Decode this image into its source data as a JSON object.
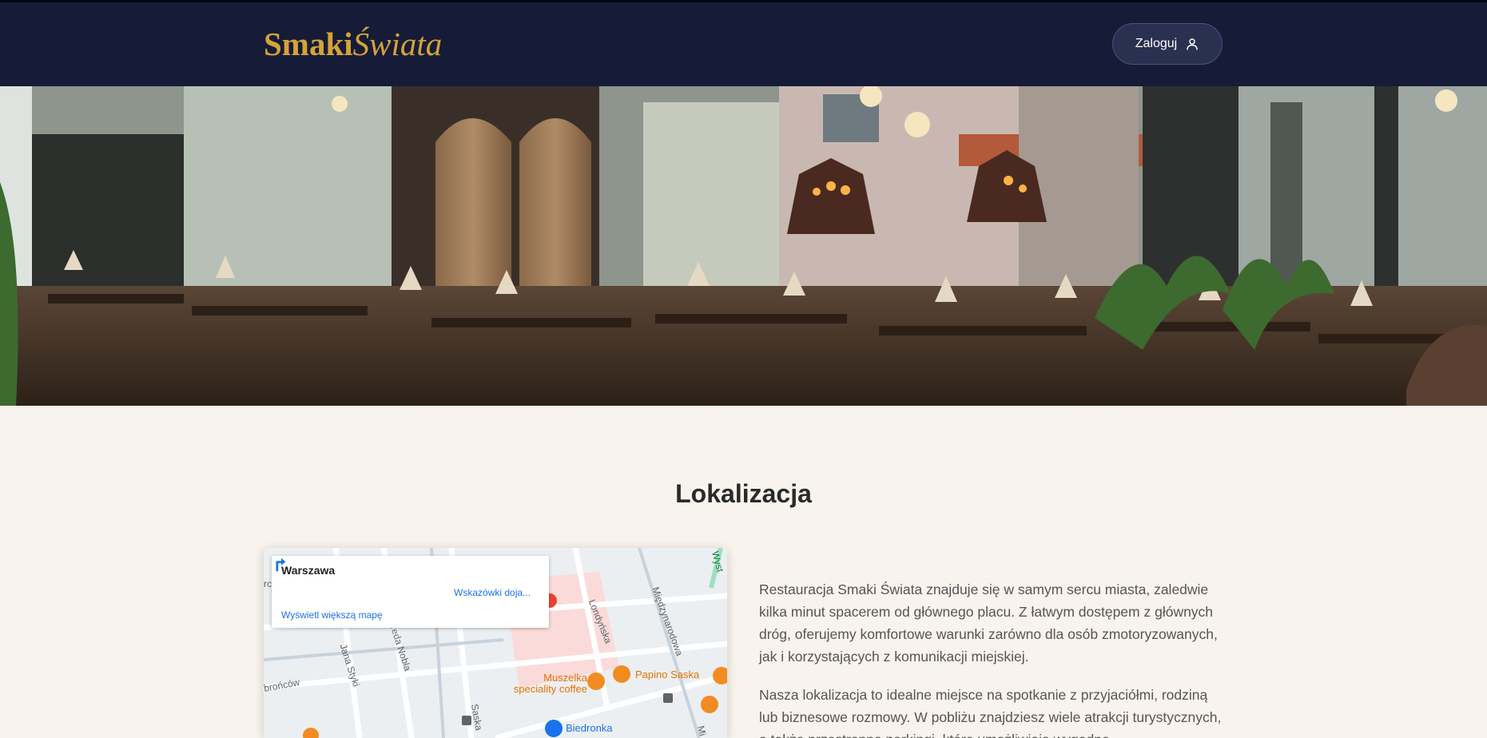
{
  "header": {
    "logo_bold": "Smaki",
    "logo_italic": "Świata",
    "login_label": "Zaloguj",
    "accent_color": "#d4a437",
    "background_color": "#161b38"
  },
  "hero": {
    "icon": "restaurant-interior-photo"
  },
  "location": {
    "title": "Lokalizacja",
    "paragraphs": [
      "Restauracja Smaki Świata znajduje się w samym sercu miasta, zaledwie kilka minut spacerem od głównego placu. Z łatwym dostępem z głównych dróg, oferujemy komfortowe warunki zarówno dla osób zmotoryzowanych, jak i korzystających z komunikacji miejskiej.",
      "Nasza lokalizacja to idealne miejsce na spotkanie z przyjaciółmi, rodziną lub biznesowe rozmowy. W pobliżu znajdziesz wiele atrakcji turystycznych, a także przestronne parkingi, które umożliwiają wygodne"
    ]
  },
  "map": {
    "place_name": "Warszawa",
    "directions_label": "Wskazówki dojazdu",
    "bigger_map_label": "Wyświetl większą mapę",
    "streets": [
      "Jana Styki",
      "Alfreda Nobla",
      "Londyńska",
      "Międzynarodowa",
      "brońców",
      "Saska",
      "Wyst",
      "Mi",
      "rc"
    ],
    "pois": [
      {
        "name": "Muszelka speciality coffee",
        "color": "#e37400"
      },
      {
        "name": "Papino Saska",
        "color": "#e37400"
      },
      {
        "name": "Biedronka",
        "color": "#1a73e8"
      }
    ]
  }
}
